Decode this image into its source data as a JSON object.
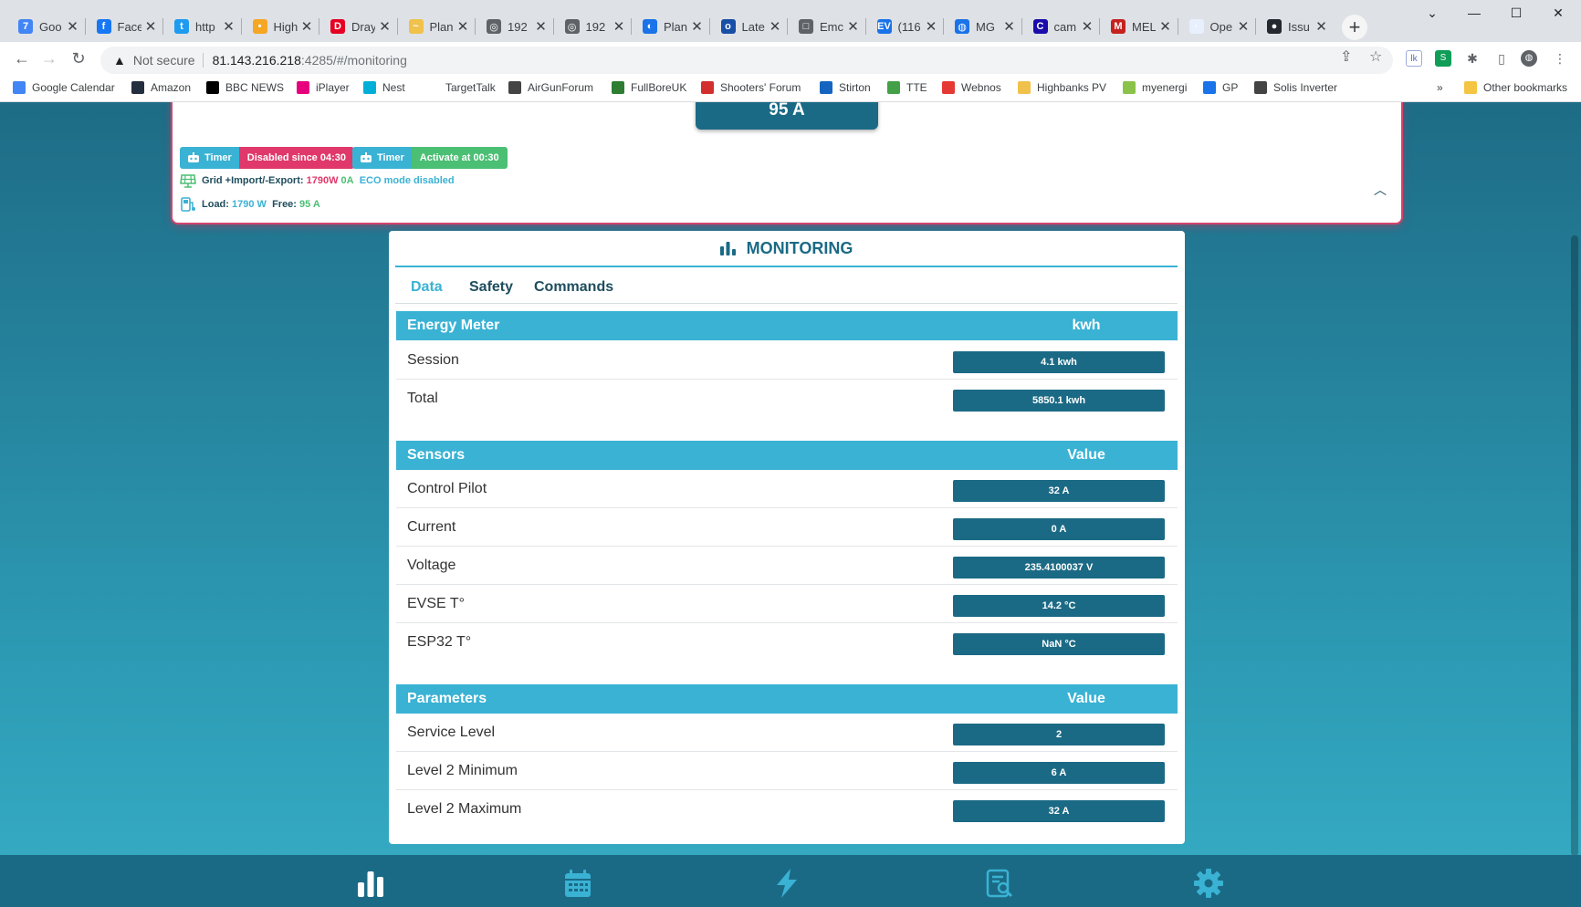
{
  "browser": {
    "tabs": [
      {
        "title": "Goo",
        "color": "#4285f4",
        "glyph": "7"
      },
      {
        "title": "Face",
        "color": "#1877f2",
        "glyph": "f"
      },
      {
        "title": "http",
        "color": "#1d9bf0",
        "glyph": "t"
      },
      {
        "title": "High",
        "color": "#f5a623",
        "glyph": "•"
      },
      {
        "title": "Dray",
        "color": "#e60023",
        "glyph": "D"
      },
      {
        "title": "Plan",
        "color": "#f0c14b",
        "glyph": "~"
      },
      {
        "title": "192",
        "color": "#5f6368",
        "glyph": "◎"
      },
      {
        "title": "192",
        "color": "#5f6368",
        "glyph": "◎"
      },
      {
        "title": "Plan",
        "color": "#1a73e8",
        "glyph": "◐"
      },
      {
        "title": "Late",
        "color": "#174ea6",
        "glyph": "o"
      },
      {
        "title": "Emc",
        "color": "#5f6368",
        "glyph": "□"
      },
      {
        "title": "(116",
        "color": "#1a73e8",
        "glyph": "EV"
      },
      {
        "title": "MG",
        "color": "#1a73e8",
        "glyph": "◍"
      },
      {
        "title": "cam",
        "color": "#1a0dab",
        "glyph": "C"
      },
      {
        "title": "MEL",
        "color": "#c5221f",
        "glyph": "M"
      },
      {
        "title": "Ope",
        "color": "#e8f0fe",
        "glyph": "·"
      },
      {
        "title": "Issu",
        "color": "#24292f",
        "glyph": "●"
      }
    ],
    "new_tab_label": "+",
    "address": {
      "not_secure": "Not secure",
      "host": "81.143.216.218",
      "path": ":4285/#/monitoring"
    },
    "bookmarks": [
      {
        "label": "Google Calendar",
        "color": "#4285f4"
      },
      {
        "label": "Amazon",
        "color": "#232f3e"
      },
      {
        "label": "BBC NEWS",
        "color": "#000000"
      },
      {
        "label": "iPlayer",
        "color": "#e6007e"
      },
      {
        "label": "Nest",
        "color": "#00afd8"
      },
      {
        "label": "TargetTalk",
        "color": "#ffffff"
      },
      {
        "label": "AirGunForum",
        "color": "#444444"
      },
      {
        "label": "FullBoreUK",
        "color": "#2e7d32"
      },
      {
        "label": "Shooters' Forum",
        "color": "#d32f2f"
      },
      {
        "label": "Stirton",
        "color": "#1565c0"
      },
      {
        "label": "TTE",
        "color": "#43a047"
      },
      {
        "label": "Webnos",
        "color": "#e53935"
      },
      {
        "label": "Highbanks PV",
        "color": "#f0c14b"
      },
      {
        "label": "myenergi",
        "color": "#8bc34a"
      },
      {
        "label": "GP",
        "color": "#1a73e8"
      },
      {
        "label": "Solis Inverter",
        "color": "#444444"
      }
    ],
    "more_bookmarks": "»",
    "other_bookmarks": "Other bookmarks"
  },
  "status": {
    "amps": "95 A",
    "timer1": {
      "label": "Timer",
      "state": "Disabled since 04:30",
      "color": "#e0386a"
    },
    "timer2": {
      "label": "Timer",
      "state": "Activate at 00:30",
      "color": "#4bbf73"
    },
    "grid": {
      "label": "Grid +Import/-Export:",
      "power": "1790W",
      "current": "0A",
      "eco": "ECO mode disabled"
    },
    "load": {
      "label": "Load:",
      "value": "1790 W",
      "free_label": "Free:",
      "free_value": "95 A"
    }
  },
  "monitoring": {
    "title": "MONITORING",
    "tabs": [
      "Data",
      "Safety",
      "Commands"
    ],
    "energy": {
      "header": "Energy Meter",
      "unit_header": "kwh",
      "rows": [
        {
          "label": "Session",
          "value": "4.1 kwh"
        },
        {
          "label": "Total",
          "value": "5850.1 kwh"
        }
      ]
    },
    "sensors": {
      "header": "Sensors",
      "unit_header": "Value",
      "rows": [
        {
          "label": "Control Pilot",
          "value": "32 A"
        },
        {
          "label": "Current",
          "value": "0 A"
        },
        {
          "label": "Voltage",
          "value": "235.4100037 V"
        },
        {
          "label": "EVSE T°",
          "value": "14.2 °C"
        },
        {
          "label": "ESP32 T°",
          "value": "NaN °C"
        }
      ]
    },
    "parameters": {
      "header": "Parameters",
      "unit_header": "Value",
      "rows": [
        {
          "label": "Service Level",
          "value": "2"
        },
        {
          "label": "Level 2 Minimum",
          "value": "6 A"
        },
        {
          "label": "Level 2 Maximum",
          "value": "32 A"
        }
      ]
    }
  },
  "colors": {
    "primary": "#1b6a85",
    "accent": "#3ab2d4",
    "alert": "#e0386a",
    "ok": "#4bbf73"
  }
}
